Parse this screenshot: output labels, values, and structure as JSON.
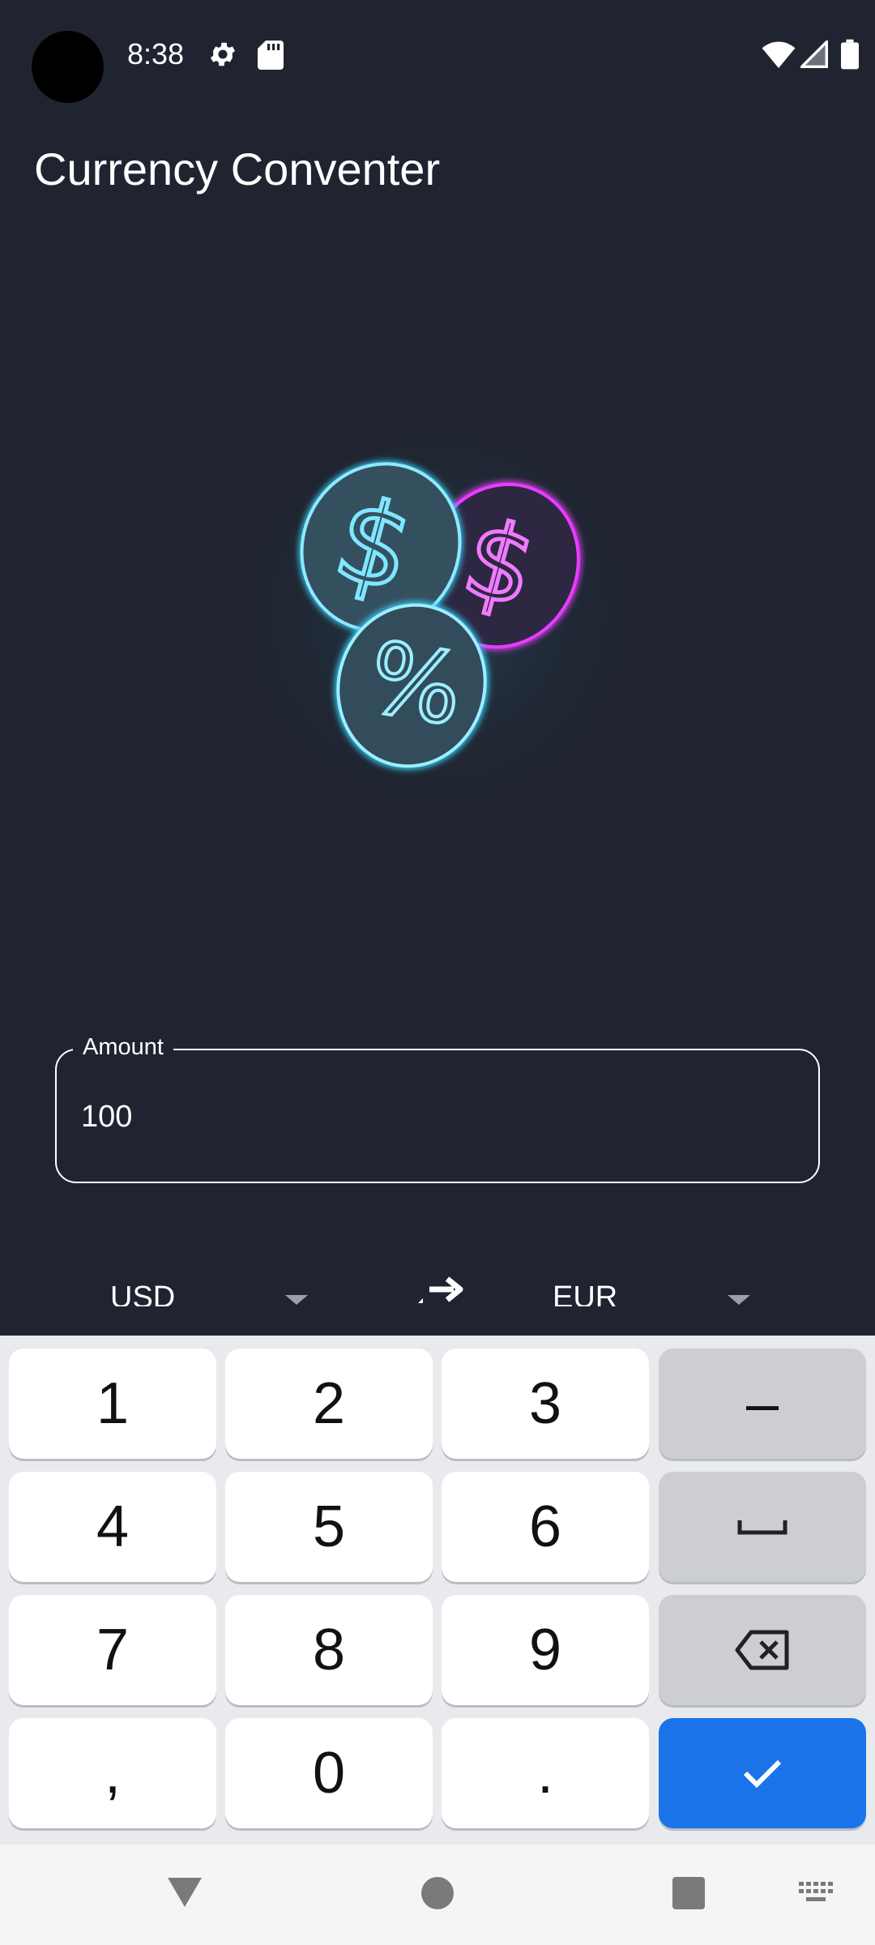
{
  "status_bar": {
    "time": "8:38",
    "icons": [
      "settings-gear-icon",
      "sd-card-icon",
      "wifi-icon",
      "cell-signal-icon",
      "battery-icon"
    ]
  },
  "app": {
    "title": "Currency Conventer",
    "hero_image": "neon-coins-illustration"
  },
  "amount_field": {
    "label": "Amount",
    "value": "100"
  },
  "converter": {
    "from_currency": "USD",
    "to_currency": "EUR",
    "swap_icon": "arrow-right-icon"
  },
  "keyboard": {
    "rows": [
      [
        "1",
        "2",
        "3",
        "–"
      ],
      [
        "4",
        "5",
        "6",
        "␣"
      ],
      [
        "7",
        "8",
        "9",
        "⌫"
      ],
      [
        ",",
        "0",
        ".",
        "✓"
      ]
    ]
  },
  "nav_bar": {
    "icons": [
      "back-icon",
      "home-icon",
      "recents-icon",
      "keyboard-icon"
    ]
  },
  "colors": {
    "background": "#1f2430",
    "keyboard_bg": "#e8eaed",
    "accent": "#1a73e8",
    "neon_cyan": "#35d6ff",
    "neon_magenta": "#e83cff"
  }
}
